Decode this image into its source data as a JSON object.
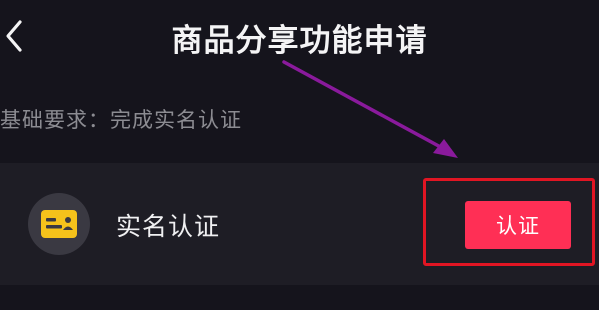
{
  "header": {
    "title": "商品分享功能申请",
    "back_icon": "chevron-left-icon"
  },
  "requirement": {
    "text": "基础要求：完成实名认证"
  },
  "card": {
    "icon": "id-card-icon",
    "icon_color": "#f5c21b",
    "label": "实名认证",
    "button_label": "认证",
    "button_color": "#ff2f55"
  },
  "annotation": {
    "highlight_color": "#e11523",
    "arrow_color": "#8a1a9c"
  }
}
